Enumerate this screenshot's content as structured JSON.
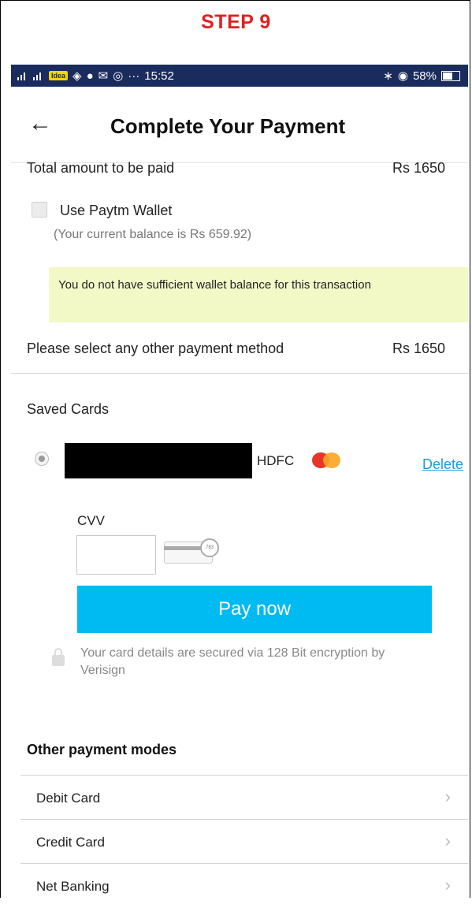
{
  "step_label": "STEP 9",
  "status_bar": {
    "carrier_badge": "Idea",
    "time": "15:52",
    "overflow": "···",
    "battery": "58%"
  },
  "header": {
    "back_icon": "←",
    "title": "Complete Your Payment"
  },
  "summary": {
    "total_label": "Total amount to be paid",
    "total_value": "Rs 1650",
    "wallet_label": "Use Paytm Wallet",
    "wallet_balance": "(Your current balance is Rs 659.92)",
    "wallet_warning": "You do not have sufficient wallet balance for this transaction",
    "other_method_label": "Please select any other payment method",
    "other_method_value": "Rs 1650"
  },
  "saved_cards": {
    "heading": "Saved Cards",
    "card_bank": "HDFC",
    "delete_label": "Delete",
    "cvv_label": "CVV",
    "cvv_value": "",
    "cvv_card_code": "783",
    "pay_label": "Pay now",
    "secure_note": "Your card details are secured via 128 Bit encryption by Verisign"
  },
  "other_modes": {
    "heading": "Other payment modes",
    "items": [
      {
        "label": "Debit Card"
      },
      {
        "label": "Credit Card"
      },
      {
        "label": "Net Banking"
      }
    ],
    "chevron": "›"
  },
  "colors": {
    "step_red": "#e02020",
    "status_bar": "#1a2b5e",
    "pay_button": "#00baf2",
    "link_blue": "#1a9ce0",
    "warning_bg": "#f3f8c7"
  }
}
